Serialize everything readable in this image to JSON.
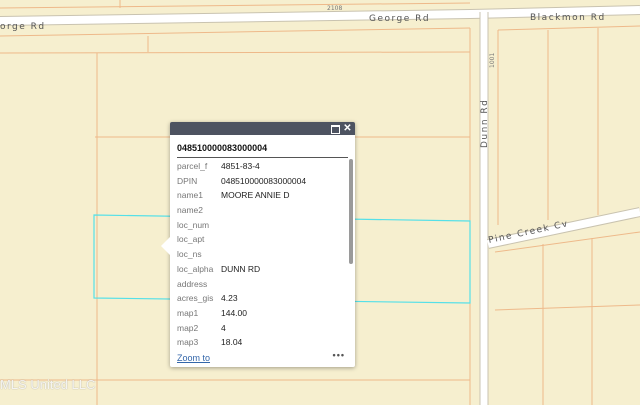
{
  "map": {
    "colors": {
      "background": "#f6efcf",
      "parcel_line": "#eeb98a",
      "road": "#ffffff",
      "road_border": "#c9c3b0",
      "selection": "#55e0e8"
    },
    "road_labels": {
      "george_left": "orge Rd",
      "george": "George Rd",
      "blackmon": "Blackmon Rd",
      "dunn": "Dunn Rd",
      "pine_creek": "Pine Creek Cv",
      "num_2108": "2108",
      "num_1001": "1001"
    },
    "watermark": "MLS United LLC"
  },
  "popup": {
    "header_icons": {
      "maximize": "maximize-icon",
      "close": "close-icon"
    },
    "close_glyph": "✕",
    "title": "048510000083000004",
    "fields": [
      {
        "key": "parcel_f",
        "value": "4851-83-4"
      },
      {
        "key": "DPIN",
        "value": "048510000083000004"
      },
      {
        "key": "name1",
        "value": "MOORE ANNIE D"
      },
      {
        "key": "name2",
        "value": ""
      },
      {
        "key": "loc_num",
        "value": ""
      },
      {
        "key": "loc_apt",
        "value": ""
      },
      {
        "key": "loc_ns",
        "value": ""
      },
      {
        "key": "loc_alpha",
        "value": "DUNN RD"
      },
      {
        "key": "address",
        "value": ""
      },
      {
        "key": "acres_gis",
        "value": "4.23"
      },
      {
        "key": "map1",
        "value": "144.00"
      },
      {
        "key": "map2",
        "value": "4"
      },
      {
        "key": "map3",
        "value": "18.04"
      }
    ],
    "zoom_label": "Zoom to",
    "more_label": "•••"
  }
}
